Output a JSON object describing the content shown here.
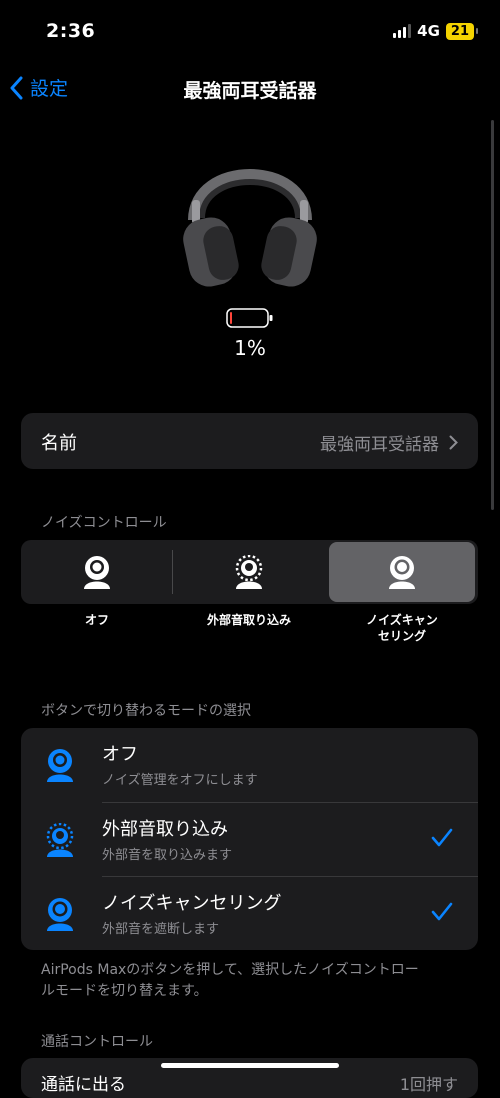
{
  "status": {
    "time": "2:36",
    "network": "4G",
    "battery": "21"
  },
  "nav": {
    "back_label": "設定",
    "title": "最強両耳受話器"
  },
  "device": {
    "battery_percent": "1%",
    "battery_level": 0.01
  },
  "name_row": {
    "label": "名前",
    "value": "最強両耳受話器"
  },
  "noise_control": {
    "header": "ノイズコントロール",
    "options": [
      {
        "label": "オフ",
        "icon": "person-icon",
        "selected": false
      },
      {
        "label": "外部音取り込み",
        "icon": "transparency-icon",
        "selected": false
      },
      {
        "label": "ノイズキャン\nセリング",
        "icon": "noise-cancel-icon",
        "selected": true
      }
    ]
  },
  "button_modes": {
    "header": "ボタンで切り替わるモードの選択",
    "items": [
      {
        "title": "オフ",
        "subtitle": "ノイズ管理をオフにします",
        "checked": false,
        "icon": "person-icon"
      },
      {
        "title": "外部音取り込み",
        "subtitle": "外部音を取り込みます",
        "checked": true,
        "icon": "transparency-icon"
      },
      {
        "title": "ノイズキャンセリング",
        "subtitle": "外部音を遮断します",
        "checked": true,
        "icon": "noise-cancel-icon"
      }
    ],
    "footer": "AirPods Maxのボタンを押して、選択したノイズコントロールモードを切り替えます。"
  },
  "call_control": {
    "header": "通話コントロール",
    "row_label": "通話に出る",
    "row_value": "1回押す"
  },
  "colors": {
    "accent": "#0a84ff",
    "background": "#000000",
    "card": "#1c1c1e"
  }
}
